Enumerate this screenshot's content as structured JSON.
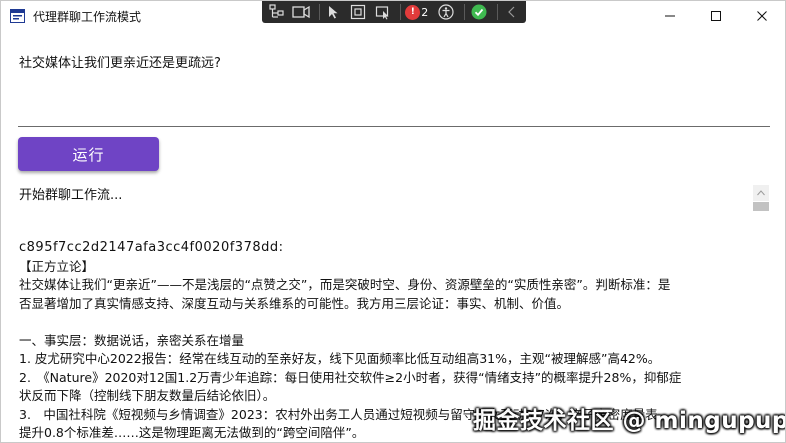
{
  "window": {
    "title": "代理群聊工作流模式"
  },
  "devtools": {
    "error_count": "2"
  },
  "form": {
    "question": "社交媒体让我们更亲近还是更疏远?",
    "run_label": "运行",
    "status": "开始群聊工作流..."
  },
  "output": {
    "lines": [
      "c895f7cc2d2147afa3cc4f0020f378dd:",
      "【正方立论】",
      "社交媒体让我们“更亲近”——不是浅层的“点赞之交”，而是突破时空、身份、资源壁垒的“实质性亲密”。判断标准：是",
      "否显著增加了真实情感支持、深度互动与关系维系的可能性。我方用三层论证：事实、机制、价值。",
      "",
      "一、事实层：数据说话，亲密关系在增量",
      "1. 皮尤研究中心2022报告：经常在线互动的至亲好友，线下见面频率比低互动组高31%，主观“被理解感”高42%。",
      "2.　《Nature》2020对12国1.2万青少年追踪：每日使用社交软件≥2小时者，获得“情绪支持”的概率提升28%，抑郁症",
      "状反而下降（控制线下朋友数量后结论依旧）。",
      "3.　中国社科院《短视频与乡情调查》2023：农村外出务工人员通过短视频与留守子女互动3.7次，亲子亲密度量表",
      "提升0.8个标准差……这是物理距离无法做到的“跨空间陪伴”。"
    ]
  },
  "watermark": "掘金技术社区 @ mingupup"
}
